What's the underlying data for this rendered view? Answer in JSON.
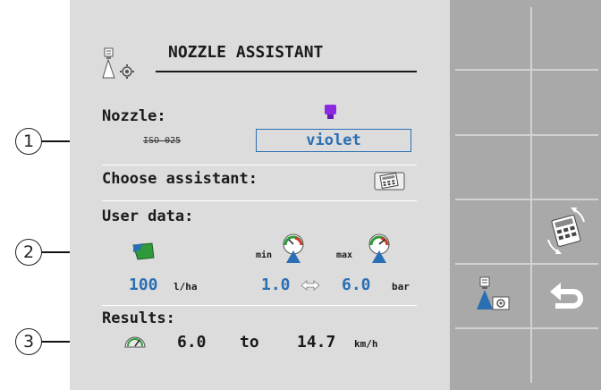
{
  "screen": {
    "title": "NOZZLE ASSISTANT",
    "nozzle": {
      "label": "Nozzle:",
      "iso_code": "ISO 025",
      "value": "violet"
    },
    "choose_assistant": {
      "label": "Choose assistant:"
    },
    "user_data": {
      "label": "User data:",
      "application_rate": "100",
      "application_rate_unit": "l/ha",
      "min_label": "min",
      "max_label": "max",
      "min_pressure": "1.0",
      "max_pressure": "6.0",
      "pressure_unit": "bar"
    },
    "results": {
      "label": "Results:",
      "speed_from": "6.0",
      "to_label": "to",
      "speed_to": "14.7",
      "speed_unit": "km/h"
    }
  },
  "callouts": [
    "1",
    "2",
    "3"
  ],
  "softkeys": {
    "icons": [
      "calculator-icon",
      "nozzle-settings-icon",
      "back-icon"
    ]
  },
  "colors": {
    "screen_bg": "#dcdcdc",
    "softkey_bg": "#a9a9a9",
    "value_blue": "#2a6fb4",
    "nozzle_violet": "#8a2be2"
  }
}
